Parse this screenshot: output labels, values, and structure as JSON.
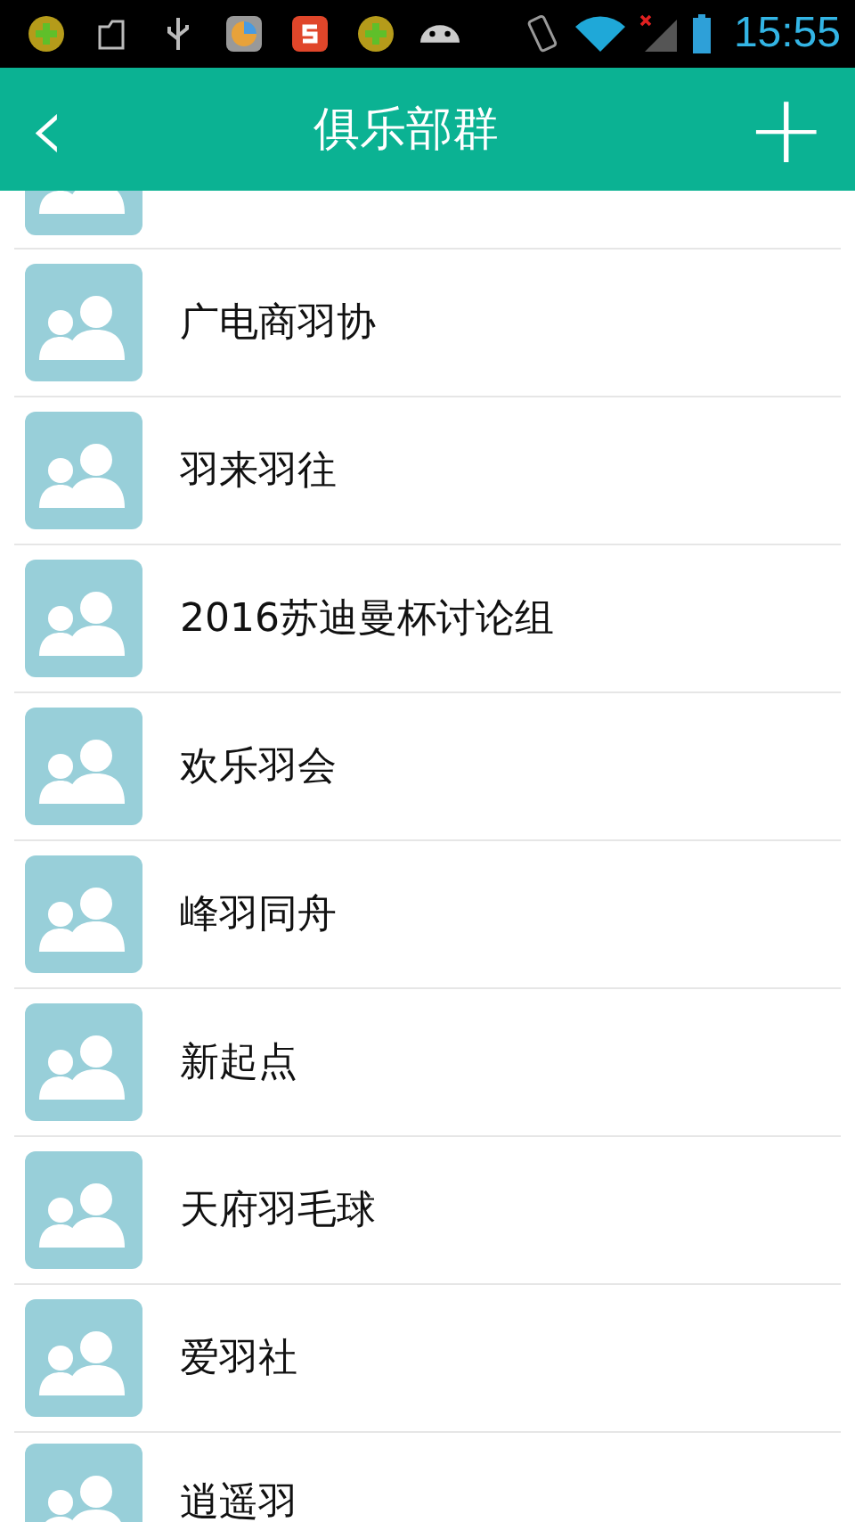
{
  "status_bar": {
    "time": "15:55"
  },
  "header": {
    "back": "‹",
    "title": "俱乐部群",
    "add": "+"
  },
  "groups": [
    {
      "kind": "partial"
    },
    {
      "kind": "full",
      "name": "广电商羽协"
    },
    {
      "kind": "full",
      "name": "羽来羽往"
    },
    {
      "kind": "full",
      "name": "2016苏迪曼杯讨论组"
    },
    {
      "kind": "full",
      "name": "欢乐羽会"
    },
    {
      "kind": "full",
      "name": "峰羽同舟"
    },
    {
      "kind": "full",
      "name": "新起点"
    },
    {
      "kind": "full",
      "name": "天府羽毛球"
    },
    {
      "kind": "full",
      "name": "爱羽社"
    },
    {
      "kind": "full",
      "name": "逍遥羽"
    }
  ]
}
